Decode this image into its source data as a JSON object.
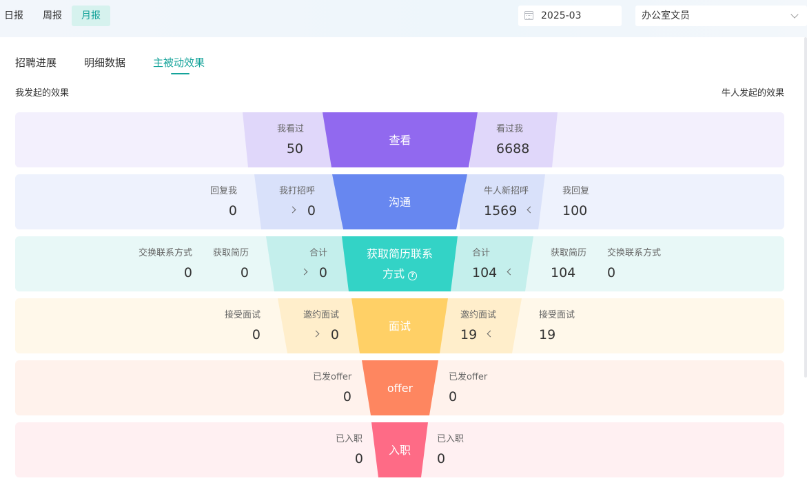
{
  "periods": [
    {
      "label": "日报"
    },
    {
      "label": "周报"
    },
    {
      "label": "月报",
      "active": true
    }
  ],
  "date": {
    "value": "2025-03",
    "icon": "calendar-icon"
  },
  "position_select": {
    "value": "办公室文员",
    "icon": "chevron-down-icon"
  },
  "tabs": [
    {
      "label": "招聘进展"
    },
    {
      "label": "明细数据"
    },
    {
      "label": "主被动效果",
      "active": true
    }
  ],
  "left_title": "我发起的效果",
  "right_title": "牛人发起的效果",
  "funnel": {
    "view": {
      "center": "查看",
      "left": {
        "label": "我看过",
        "value": "50"
      },
      "right": {
        "label": "看过我",
        "value": "6688"
      }
    },
    "chat": {
      "center": "沟通",
      "left_outer": {
        "label": "回复我",
        "value": "0"
      },
      "left": {
        "label": "我打招呼",
        "value": "0"
      },
      "right": {
        "label": "牛人新招呼",
        "value": "1569"
      },
      "right_outer": {
        "label": "我回复",
        "value": "100"
      }
    },
    "contact": {
      "center_line1": "获取简历联系",
      "center_line2": "方式",
      "help_icon": "?",
      "left_outer2": {
        "label": "交换联系方式",
        "value": "0"
      },
      "left_outer1": {
        "label": "获取简历",
        "value": "0"
      },
      "left": {
        "label": "合计",
        "value": "0"
      },
      "right": {
        "label": "合计",
        "value": "104"
      },
      "right_outer1": {
        "label": "获取简历",
        "value": "104"
      },
      "right_outer2": {
        "label": "交换联系方式",
        "value": "0"
      }
    },
    "interview": {
      "center": "面试",
      "left_outer": {
        "label": "接受面试",
        "value": "0"
      },
      "left": {
        "label": "邀约面试",
        "value": "0"
      },
      "right": {
        "label": "邀约面试",
        "value": "19"
      },
      "right_outer": {
        "label": "接受面试",
        "value": "19"
      }
    },
    "offer": {
      "center": "offer",
      "left": {
        "label": "已发offer",
        "value": "0"
      },
      "right": {
        "label": "已发offer",
        "value": "0"
      }
    },
    "onboard": {
      "center": "入职",
      "left": {
        "label": "已入职",
        "value": "0"
      },
      "right": {
        "label": "已入职",
        "value": "0"
      }
    }
  },
  "colors": {
    "accent": "#14a39a",
    "view_bg": "#f3f0fd",
    "view_side": "#e0d7fa",
    "view_center": "#9169ef",
    "chat_bg": "#eef2fd",
    "chat_side": "#d9e1fa",
    "chat_center": "#6787f0",
    "contact_bg": "#e8f8f7",
    "contact_side": "#c4efec",
    "contact_center": "#33d3c6",
    "interview_bg": "#fff8ea",
    "interview_side": "#ffeecb",
    "interview_center": "#ffd066",
    "offer_bg": "#fff2ec",
    "offer_center": "#fe8660",
    "onboard_bg": "#fff0f2",
    "onboard_center": "#fe6b86"
  }
}
